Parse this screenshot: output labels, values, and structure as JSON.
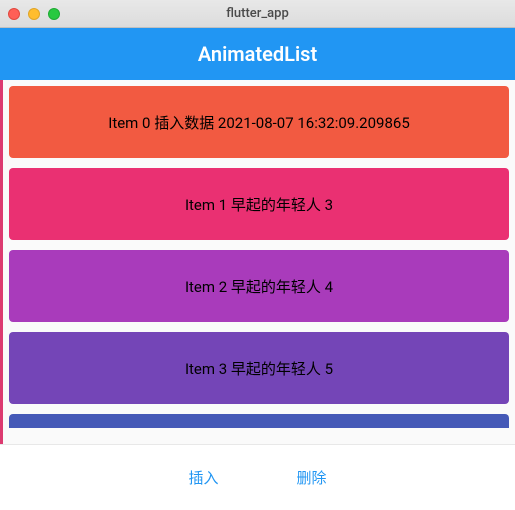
{
  "window": {
    "title": "flutter_app"
  },
  "appbar": {
    "title": "AnimatedList"
  },
  "list": {
    "items": [
      {
        "label": "Item 0 插入数据 2021-08-07 16:32:09.209865",
        "color": "#f25a41"
      },
      {
        "label": "Item 1 早起的年轻人 3",
        "color": "#ea3072"
      },
      {
        "label": "Item 2 早起的年轻人 4",
        "color": "#a93bbb"
      },
      {
        "label": "Item 3 早起的年轻人 5",
        "color": "#7445b7"
      },
      {
        "label": "",
        "color": "#4559b7"
      }
    ]
  },
  "actions": {
    "insert": "插入",
    "delete": "删除"
  }
}
